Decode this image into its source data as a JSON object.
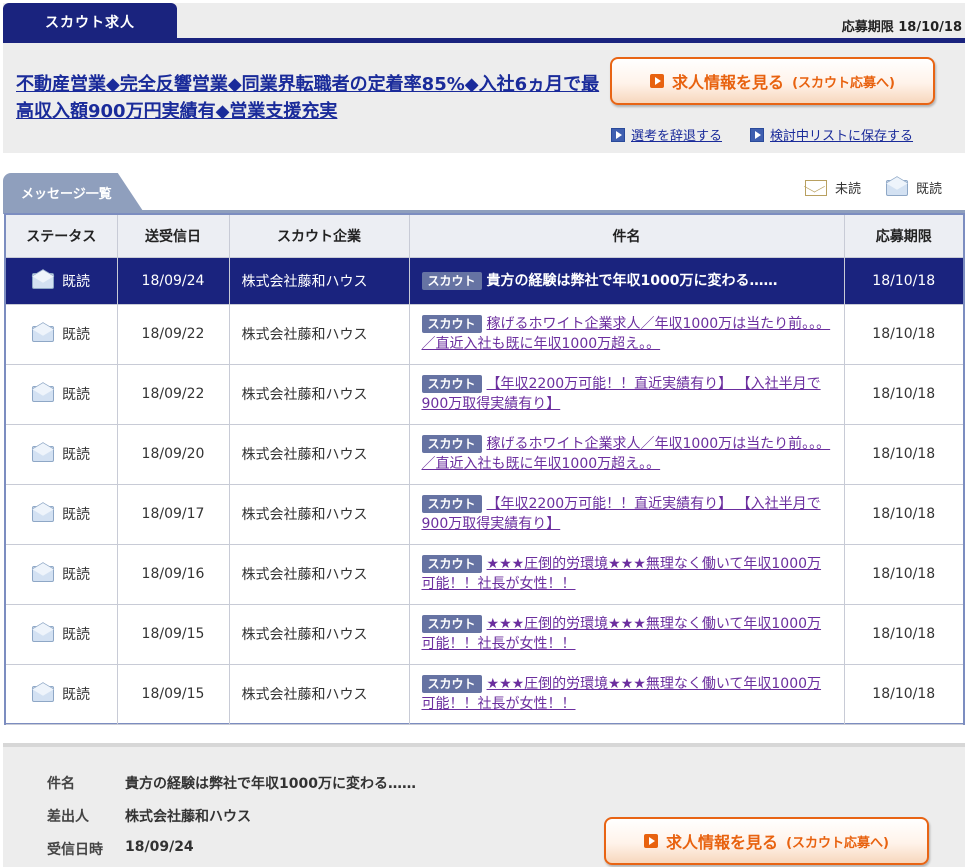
{
  "scout": {
    "tab_label": "スカウト求人",
    "deadline": "応募期限 18/10/18",
    "job_title": "不動産営業◆完全反響営業◆同業界転職者の定着率85%◆入社6ヵ月で最高収入額900万円実績有◆営業支援充実",
    "view_button": {
      "label": "求人情報を見る",
      "sub": "(スカウト応募へ)"
    },
    "decline_link": "選考を辞退する",
    "save_link": "検討中リストに保存する"
  },
  "messages": {
    "tab_label": "メッセージ一覧",
    "legend": {
      "unread": "未読",
      "read": "既読"
    },
    "columns": [
      "ステータス",
      "送受信日",
      "スカウト企業",
      "件名",
      "応募期限"
    ],
    "rows": [
      {
        "status": "既読",
        "date": "18/09/24",
        "company": "株式会社藤和ハウス",
        "badge": "スカウト",
        "subject": "貴方の経験は弊社で年収1000万に変わる……",
        "deadline": "18/10/18"
      },
      {
        "status": "既読",
        "date": "18/09/22",
        "company": "株式会社藤和ハウス",
        "badge": "スカウト",
        "subject": "稼げるホワイト企業求人／年収1000万は当たり前。。。／直近入社も既に年収1000万超え。。",
        "deadline": "18/10/18"
      },
      {
        "status": "既読",
        "date": "18/09/22",
        "company": "株式会社藤和ハウス",
        "badge": "スカウト",
        "subject": "【年収2200万可能！！直近実績有り】 【入社半月で900万取得実績有り】",
        "deadline": "18/10/18"
      },
      {
        "status": "既読",
        "date": "18/09/20",
        "company": "株式会社藤和ハウス",
        "badge": "スカウト",
        "subject": "稼げるホワイト企業求人／年収1000万は当たり前。。。／直近入社も既に年収1000万超え。。",
        "deadline": "18/10/18"
      },
      {
        "status": "既読",
        "date": "18/09/17",
        "company": "株式会社藤和ハウス",
        "badge": "スカウト",
        "subject": "【年収2200万可能！！直近実績有り】 【入社半月で900万取得実績有り】",
        "deadline": "18/10/18"
      },
      {
        "status": "既読",
        "date": "18/09/16",
        "company": "株式会社藤和ハウス",
        "badge": "スカウト",
        "subject": "★★★圧倒的労環境★★★無理なく働いて年収1000万可能！！社長が女性！！",
        "deadline": "18/10/18"
      },
      {
        "status": "既読",
        "date": "18/09/15",
        "company": "株式会社藤和ハウス",
        "badge": "スカウト",
        "subject": "★★★圧倒的労環境★★★無理なく働いて年収1000万可能！！社長が女性！！",
        "deadline": "18/10/18"
      },
      {
        "status": "既読",
        "date": "18/09/15",
        "company": "株式会社藤和ハウス",
        "badge": "スカウト",
        "subject": "★★★圧倒的労環境★★★無理なく働いて年収1000万可能！！社長が女性！！",
        "deadline": "18/10/18"
      }
    ]
  },
  "detail": {
    "subject_label": "件名",
    "subject": "貴方の経験は弊社で年収1000万に変わる……",
    "sender_label": "差出人",
    "sender": "株式会社藤和ハウス",
    "received_label": "受信日時",
    "received": "18/09/24",
    "view_button": {
      "label": "求人情報を見る",
      "sub": "(スカウト応募へ)"
    }
  }
}
